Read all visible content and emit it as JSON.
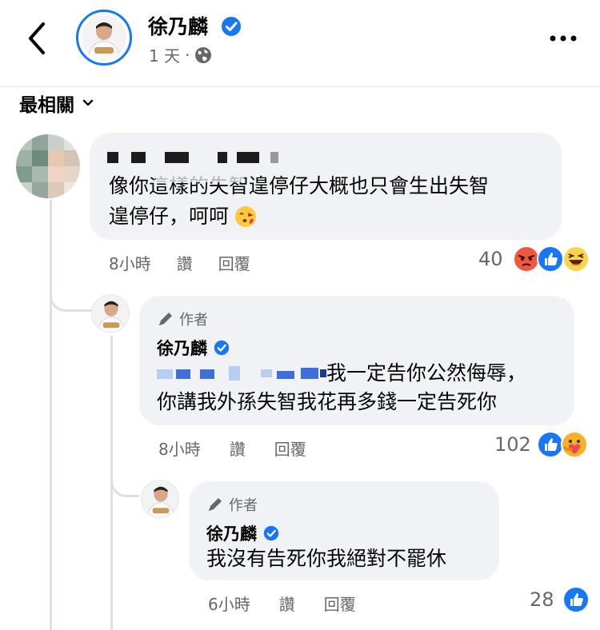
{
  "header": {
    "name": "徐乃麟",
    "time": "1 天",
    "separator": "·"
  },
  "sort": {
    "label": "最相關"
  },
  "comments": [
    {
      "text": "像你這樣的失智遑停仔大概也只會生出失智遑停仔，呵呵",
      "line1": "像你這樣的失智遑停仔大概也只會生出失智",
      "line2": "遑停仔，呵呵",
      "time": "8小時",
      "like_label": "讚",
      "reply_label": "回覆",
      "reaction_count": "40"
    },
    {
      "author_tag": "作者",
      "name": "徐乃麟",
      "line1": "我一定告你公然侮辱，",
      "line2": "你講我外孫失智我花再多錢一定告死你",
      "time": "8小時",
      "like_label": "讚",
      "reply_label": "回覆",
      "reaction_count": "102"
    },
    {
      "author_tag": "作者",
      "name": "徐乃麟",
      "line1": "我沒有告死你我絕對不罷休",
      "time": "6小時",
      "like_label": "讚",
      "reply_label": "回覆",
      "reaction_count": "28"
    }
  ],
  "icons": {
    "back": "chevron-left-icon",
    "more": "more-dots-icon",
    "verified": "verified-badge-icon",
    "globe": "globe-icon",
    "author": "pencil-icon",
    "sort": "chevron-down-icon",
    "reactions": [
      "angry-icon",
      "like-icon",
      "haha-icon",
      "care-icon"
    ]
  },
  "colors": {
    "accent": "#1877f2",
    "bubble": "#f0f2f5",
    "secondary_text": "#65676b"
  }
}
